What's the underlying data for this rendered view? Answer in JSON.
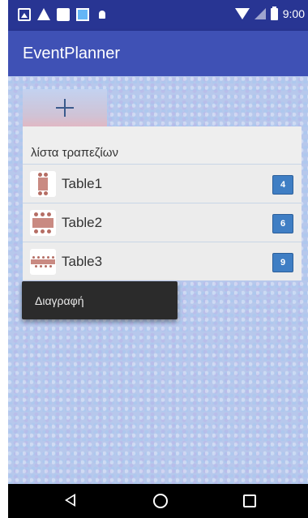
{
  "status_bar": {
    "time": "9:00",
    "left_icons": [
      "gallery-icon",
      "warning-icon",
      "save-icon",
      "photo-icon",
      "android-debug-icon"
    ],
    "right_icons": [
      "wifi-icon",
      "signal-icon",
      "battery-icon"
    ]
  },
  "app_bar": {
    "title": "EventPlanner",
    "color": "#3f51b5",
    "status_color": "#283593"
  },
  "add_button": {
    "icon": "plus-icon"
  },
  "list": {
    "header": "λίστα τραπεζίων",
    "items": [
      {
        "label": "Table1",
        "count": "4",
        "icon": "table-4-seats-icon"
      },
      {
        "label": "Table2",
        "count": "6",
        "icon": "table-6-seats-icon"
      },
      {
        "label": "Table3",
        "count": "9",
        "icon": "table-9-seats-icon"
      }
    ],
    "badge_color": "#3f7ec4"
  },
  "context_menu": {
    "items": [
      "Διαγραφή"
    ]
  },
  "nav_bar": {
    "buttons": [
      "back-icon",
      "home-icon",
      "recent-apps-icon"
    ]
  }
}
